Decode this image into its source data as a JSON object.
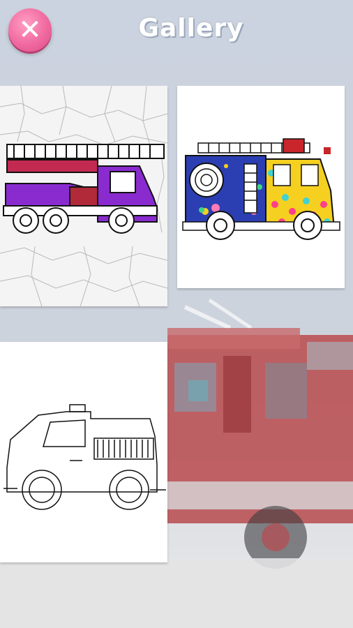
{
  "header": {
    "title": "Gallery",
    "close_icon": "close-icon"
  },
  "gallery": {
    "items": [
      {
        "name": "ladder-fire-truck",
        "style": "purple-glitter on cracked texture"
      },
      {
        "name": "fire-engine",
        "style": "patterned colorful fill"
      },
      {
        "name": "pickup-truck",
        "style": "uncolored outline"
      }
    ]
  },
  "colors": {
    "accent_pink": "#f06aa0",
    "title_white": "#ffffff",
    "purple": "#8a2bd0",
    "red": "#c8262a",
    "blue": "#2b3fb3",
    "yellow": "#f5d020"
  }
}
